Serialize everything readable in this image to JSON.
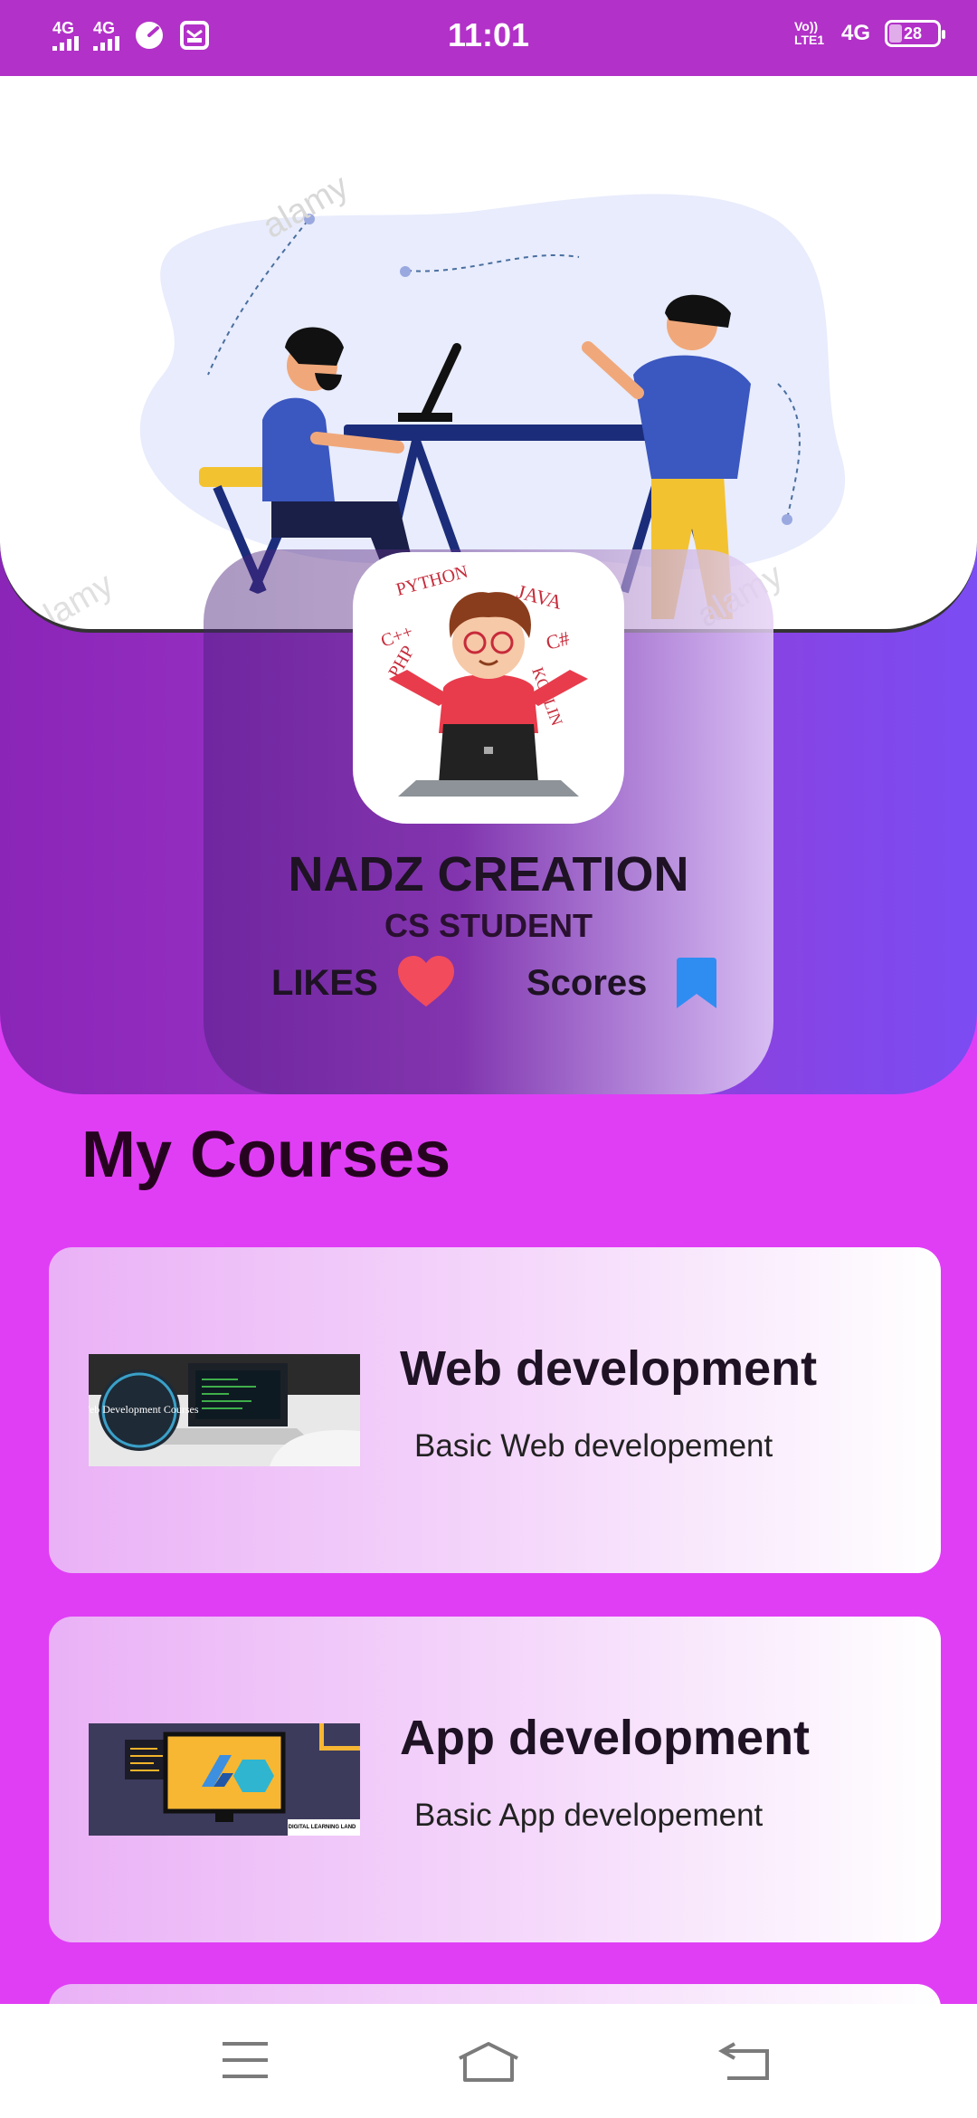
{
  "status_bar": {
    "time": "11:01",
    "network_1": "4G",
    "network_2": "4G",
    "volte": "Vo)) LTE1",
    "network_right": "4G",
    "battery": "28"
  },
  "hero": {
    "watermark": "alamy"
  },
  "profile": {
    "name": "NADZ CREATION",
    "role": "CS STUDENT",
    "likes_label": "LIKES",
    "scores_label": "Scores",
    "logo_words": [
      "PYTHON",
      "JAVA",
      "C++",
      "C#",
      "PHP",
      "KOTLIN"
    ]
  },
  "colors": {
    "accent": "#e03ef5",
    "heart": "#f24b5c",
    "bookmark": "#2f8df2"
  },
  "section": {
    "title": "My Courses"
  },
  "courses": [
    {
      "title": "Web development",
      "subtitle": "Basic Web developement",
      "thumb_text": "Web Development Courses"
    },
    {
      "title": "App development",
      "subtitle": "Basic App developement",
      "thumb_text": "DIGITAL LEARNING LAND"
    }
  ],
  "nav": {
    "icons": [
      "menu-icon",
      "home-icon",
      "back-icon"
    ]
  }
}
